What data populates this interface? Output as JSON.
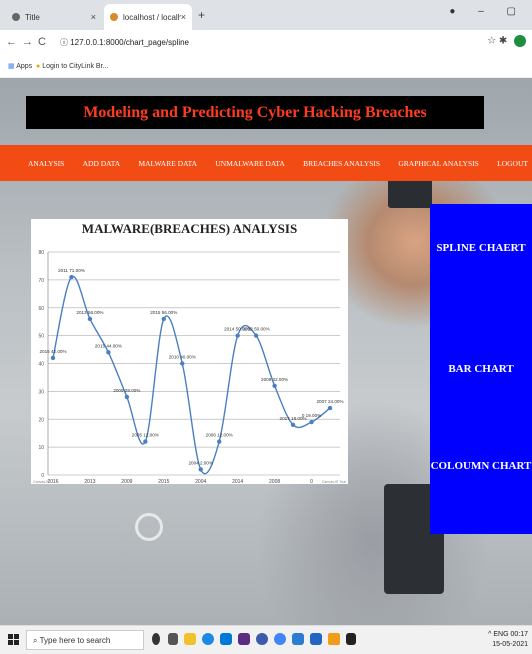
{
  "browser": {
    "tabs": [
      {
        "label": "Title"
      },
      {
        "label": "localhost / localhost / hacking /"
      }
    ],
    "new_tab": "+",
    "url": "127.0.0.1:8000/chart_page/spline",
    "bookmarks": {
      "apps_label": "Apps",
      "item_label": "Login to CityLink Br..."
    }
  },
  "page": {
    "banner_title": "Modeling and Predicting Cyber Hacking Breaches",
    "nav": [
      {
        "label": "ANALYSIS"
      },
      {
        "label": "ADD DATA"
      },
      {
        "label": "MALWARE DATA"
      },
      {
        "label": "UNMALWARE DATA"
      },
      {
        "label": "BREACHES ANALYSIS"
      },
      {
        "label": "GRAPHICAL ANALYSIS"
      },
      {
        "label": "LOGOUT"
      }
    ],
    "side_buttons": [
      {
        "label": "SPLINE CHAERT"
      },
      {
        "label": "BAR CHART"
      },
      {
        "label": "COLOUMN CHART"
      }
    ]
  },
  "chart_data": {
    "type": "line",
    "subtype": "spline",
    "title": "MALWARE(BREACHES) ANALYSIS",
    "ylim": [
      0,
      80
    ],
    "yticks": [
      0,
      10,
      20,
      30,
      40,
      50,
      60,
      70,
      80
    ],
    "grid": true,
    "color": "#4a7fc1",
    "points": [
      {
        "x": "2016",
        "y": 42,
        "label": "2016 42.00%"
      },
      {
        "x": "2011",
        "y": 71,
        "label": "2011 71.00%"
      },
      {
        "x": "2013",
        "y": 56,
        "label": "2013 56.00%"
      },
      {
        "x": "2015",
        "y": 44,
        "label": "2015 44.00%"
      },
      {
        "x": "2009",
        "y": 28,
        "label": "2009 28.00%"
      },
      {
        "x": "2005",
        "y": 12,
        "label": "2005 12.00%"
      },
      {
        "x": "2015",
        "y": 56,
        "label": "2015 56.00%"
      },
      {
        "x": "2010",
        "y": 40,
        "label": "2010 40.00%"
      },
      {
        "x": "2004",
        "y": 2,
        "label": "2004 2.00%"
      },
      {
        "x": "2006",
        "y": 12,
        "label": "2006 12.00%"
      },
      {
        "x": "2014",
        "y": 50,
        "label": "2014 50.00%"
      },
      {
        "x": "2012",
        "y": 50,
        "label": "2012 50.00%"
      },
      {
        "x": "2008",
        "y": 32,
        "label": "2008 32.00%"
      },
      {
        "x": "2017",
        "y": 18,
        "label": "2017 18.00%"
      },
      {
        "x": "0",
        "y": 19,
        "label": "0 19.00%"
      },
      {
        "x": "2007",
        "y": 24,
        "label": "2007 24.00%"
      }
    ],
    "x_tick_labels": [
      "2016",
      "2013",
      "2009",
      "2015",
      "2004",
      "2014",
      "2008",
      "0"
    ],
    "credits_left": "CanvasJS",
    "credits_right": "CanvasJS Trial"
  },
  "taskbar": {
    "search_placeholder": "Type here to search",
    "tray_text": "^ ENG",
    "time": "00:17",
    "date": "15-05-2021"
  },
  "colors": {
    "navbar": "#f24b14",
    "banner_bg": "#000000",
    "banner_text": "#ff3b1f",
    "side_panel": "#0000ff"
  }
}
